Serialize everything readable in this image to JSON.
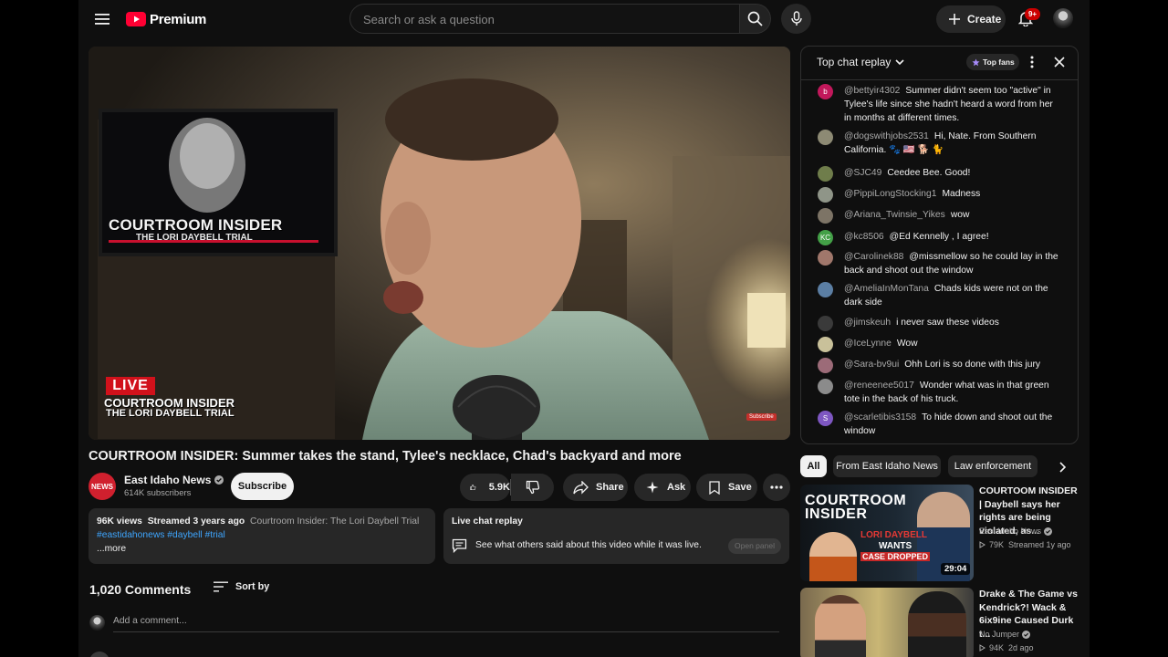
{
  "header": {
    "brand": "Premium",
    "search_placeholder": "Search or ask a question",
    "create_label": "Create",
    "notification_count": "9+"
  },
  "player": {
    "tv_title_line1": "COURTROOM INSIDER",
    "tv_title_line2": "THE LORI DAYBELL TRIAL",
    "live_badge": "LIVE",
    "lower_third_line1": "COURTROOM INSIDER",
    "lower_third_line2": "THE LORI DAYBELL TRIAL",
    "subscribe_watermark": "Subscribe"
  },
  "video": {
    "title": "COURTROOM INSIDER: Summer takes the stand, Tylee's necklace, Chad's backyard and more",
    "channel_name": "East Idaho News",
    "channel_logo_text": "NEWS",
    "subscribers": "614K subscribers",
    "subscribe_label": "Subscribe",
    "likes": "5.9K",
    "share_label": "Share",
    "ask_label": "Ask",
    "save_label": "Save"
  },
  "description": {
    "views": "96K views",
    "streamed": "Streamed 3 years ago",
    "playlist": "Courtroom Insider: The Lori Daybell Trial",
    "hashtags": "#eastidahonews #daybell #trial",
    "more": "...more"
  },
  "live_chat_card": {
    "title": "Live chat replay",
    "text": "See what others said about this video while it was live.",
    "button": "Open panel"
  },
  "comments": {
    "count": "1,020 Comments",
    "sort_label": "Sort by",
    "placeholder": "Add a comment..."
  },
  "chat": {
    "header": "Top chat replay",
    "top_fans": "Top fans",
    "messages": [
      {
        "author": "@bettyir4302",
        "text": "Summer didn't seem too \"active\" in Tylee's life since she hadn't heard a word from her in months at different times.",
        "avatar_letter": "b",
        "avatar_color": "#c2185b"
      },
      {
        "author": "@dogswithjobs2531",
        "text": "Hi, Nate. From Southern California. 🐾 🇺🇸 🐕 🐈",
        "avatar_letter": "",
        "avatar_color": "#8d8a74"
      },
      {
        "author": "@SJC49",
        "text": "Ceedee Bee. Good!",
        "avatar_letter": "",
        "avatar_color": "#6f7d4b"
      },
      {
        "author": "@PippiLongStocking1",
        "text": "Madness",
        "avatar_letter": "",
        "avatar_color": "#8f9588"
      },
      {
        "author": "@Ariana_Twinsie_Yikes",
        "text": "wow",
        "avatar_letter": "",
        "avatar_color": "#7d7466"
      },
      {
        "author": "@kc8506",
        "text": "@Ed Kennelly , I agree!",
        "avatar_letter": "KC",
        "avatar_color": "#43a047"
      },
      {
        "author": "@Carolinek88",
        "text": "@missmellow so he could lay in the back and shoot out the window",
        "avatar_letter": "",
        "avatar_color": "#a0776b"
      },
      {
        "author": "@AmeliaInMonTana",
        "text": "Chads kids were not on the dark side",
        "avatar_letter": "",
        "avatar_color": "#5b7ea3"
      },
      {
        "author": "@jimskeuh",
        "text": "i never saw these videos",
        "avatar_letter": "",
        "avatar_color": "#3a3a3a"
      },
      {
        "author": "@IceLynne",
        "text": "Wow",
        "avatar_letter": "",
        "avatar_color": "#c9c19a"
      },
      {
        "author": "@Sara-bv9ui",
        "text": "Ohh Lori is so done with this jury",
        "avatar_letter": "",
        "avatar_color": "#9c6b78"
      },
      {
        "author": "@reneenee5017",
        "text": "Wonder what was in that green tote in the back of his truck.",
        "avatar_letter": "",
        "avatar_color": "#8b8b8b"
      },
      {
        "author": "@scarletibis3158",
        "text": "To hide down and shoot out the window",
        "avatar_letter": "S",
        "avatar_color": "#7e57c2"
      }
    ]
  },
  "chips": [
    "All",
    "From East Idaho News",
    "Law enforcement"
  ],
  "recommendations": [
    {
      "title": "COURTOOM INSIDER | Daybell says her rights are being violated, as...",
      "channel": "East Idaho News",
      "meta": "79K  Streamed 1y ago",
      "duration": "29:04",
      "thumb_line1": "COURTROOM",
      "thumb_line2": "INSIDER",
      "thumb_line3": "LORI DAYBELL",
      "thumb_line4": "WANTS",
      "thumb_line5": "CASE DROPPED"
    },
    {
      "title": "Drake & The Game vs Kendrick?! Wack & 6ix9ine Caused Durk t...",
      "channel": "No Jumper",
      "meta": "94K  2d ago"
    }
  ]
}
